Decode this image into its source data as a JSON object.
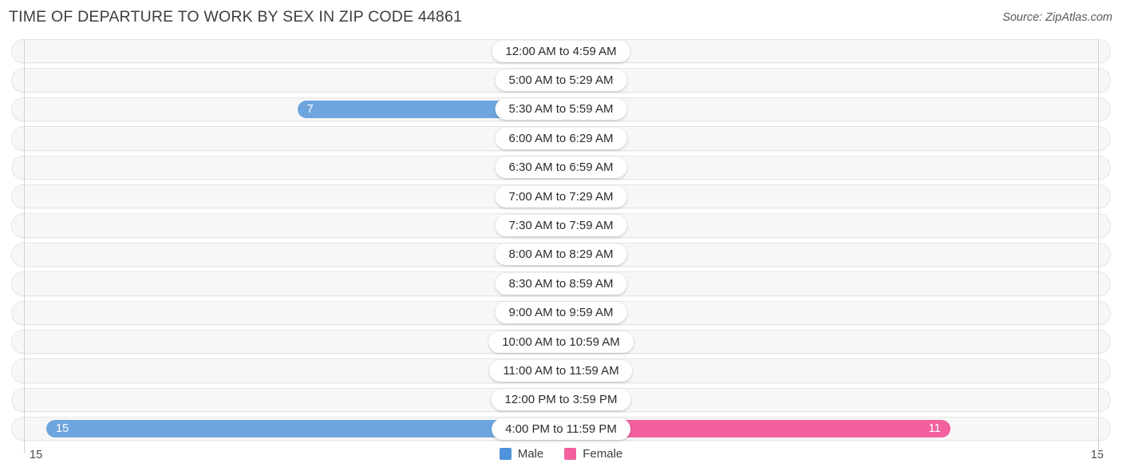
{
  "header": {
    "title": "TIME OF DEPARTURE TO WORK BY SEX IN ZIP CODE 44861",
    "source": "Source: ZipAtlas.com"
  },
  "legend": {
    "male_label": "Male",
    "female_label": "Female",
    "male_color": "#4f92dd",
    "female_color": "#f2609e"
  },
  "axis": {
    "left_max": "15",
    "right_max": "15"
  },
  "colors": {
    "male_bar": "#6fa5de",
    "male_bar_zero": "#a9c9ea",
    "female_bar": "#f2609e",
    "female_bar_zero": "#f4aec9",
    "row_track": "#f7f7f7",
    "gridline": "#d0d0d0"
  },
  "chart_data": {
    "type": "bar",
    "title": "TIME OF DEPARTURE TO WORK BY SEX IN ZIP CODE 44861",
    "subtitle": "Source: ZipAtlas.com",
    "orientation": "horizontal-diverging",
    "xlabel": "",
    "ylabel": "",
    "xlim_left": [
      0,
      15
    ],
    "xlim_right": [
      0,
      15
    ],
    "grid": true,
    "legend_position": "bottom-center",
    "categories": [
      "12:00 AM to 4:59 AM",
      "5:00 AM to 5:29 AM",
      "5:30 AM to 5:59 AM",
      "6:00 AM to 6:29 AM",
      "6:30 AM to 6:59 AM",
      "7:00 AM to 7:29 AM",
      "7:30 AM to 7:59 AM",
      "8:00 AM to 8:29 AM",
      "8:30 AM to 8:59 AM",
      "9:00 AM to 9:59 AM",
      "10:00 AM to 10:59 AM",
      "11:00 AM to 11:59 AM",
      "12:00 PM to 3:59 PM",
      "4:00 PM to 11:59 PM"
    ],
    "series": [
      {
        "name": "Male",
        "values": [
          0,
          0,
          7,
          0,
          0,
          0,
          0,
          0,
          0,
          0,
          0,
          0,
          0,
          15
        ]
      },
      {
        "name": "Female",
        "values": [
          0,
          0,
          0,
          0,
          0,
          0,
          0,
          0,
          0,
          0,
          0,
          0,
          0,
          11
        ]
      }
    ]
  },
  "rows": [
    {
      "label": "12:00 AM to 4:59 AM",
      "male": "0",
      "female": "0"
    },
    {
      "label": "5:00 AM to 5:29 AM",
      "male": "0",
      "female": "0"
    },
    {
      "label": "5:30 AM to 5:59 AM",
      "male": "7",
      "female": "0"
    },
    {
      "label": "6:00 AM to 6:29 AM",
      "male": "0",
      "female": "0"
    },
    {
      "label": "6:30 AM to 6:59 AM",
      "male": "0",
      "female": "0"
    },
    {
      "label": "7:00 AM to 7:29 AM",
      "male": "0",
      "female": "0"
    },
    {
      "label": "7:30 AM to 7:59 AM",
      "male": "0",
      "female": "0"
    },
    {
      "label": "8:00 AM to 8:29 AM",
      "male": "0",
      "female": "0"
    },
    {
      "label": "8:30 AM to 8:59 AM",
      "male": "0",
      "female": "0"
    },
    {
      "label": "9:00 AM to 9:59 AM",
      "male": "0",
      "female": "0"
    },
    {
      "label": "10:00 AM to 10:59 AM",
      "male": "0",
      "female": "0"
    },
    {
      "label": "11:00 AM to 11:59 AM",
      "male": "0",
      "female": "0"
    },
    {
      "label": "12:00 PM to 3:59 PM",
      "male": "0",
      "female": "0"
    },
    {
      "label": "4:00 PM to 11:59 PM",
      "male": "15",
      "female": "11"
    }
  ]
}
